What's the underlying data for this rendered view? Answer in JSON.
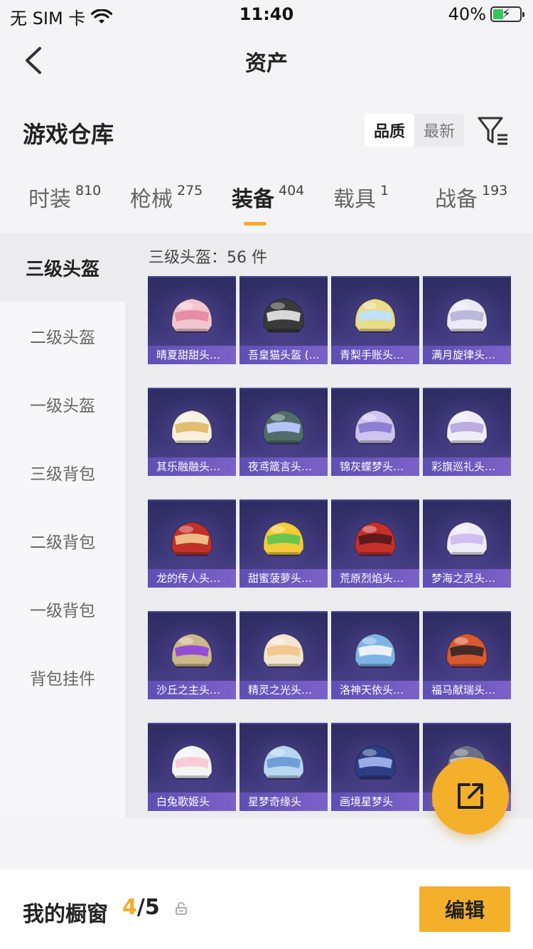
{
  "status_bar": {
    "carrier": "无 SIM 卡",
    "time": "11:40",
    "battery": "40%",
    "battery_level": 0.4
  },
  "nav": {
    "title": "资产"
  },
  "header": {
    "title": "游戏仓库",
    "sort_options": [
      "品质",
      "最新"
    ],
    "active_sort": "品质"
  },
  "tabs": [
    {
      "label": "时装",
      "count": "810"
    },
    {
      "label": "枪械",
      "count": "275"
    },
    {
      "label": "装备",
      "count": "404"
    },
    {
      "label": "载具",
      "count": "1"
    },
    {
      "label": "战备",
      "count": "193"
    }
  ],
  "active_tab": "装备",
  "sidebar": {
    "items": [
      "三级头盔",
      "二级头盔",
      "一级头盔",
      "三级背包",
      "二级背包",
      "一级背包",
      "背包挂件"
    ],
    "active": "三级头盔"
  },
  "grid": {
    "count_label": "三级头盔：56 件",
    "items": [
      {
        "name": "晴夏甜甜头…",
        "color": "#f3c6cf",
        "accent": "#e889a6"
      },
      {
        "name": "吾皇猫头盔 (…",
        "color": "#3a3a3a",
        "accent": "#e0e0e0"
      },
      {
        "name": "青梨手账头…",
        "color": "#e9dc8a",
        "accent": "#bfe3ff"
      },
      {
        "name": "满月旋律头…",
        "color": "#eceaf4",
        "accent": "#b9b5d9"
      },
      {
        "name": "其乐融融头…",
        "color": "#f7f0df",
        "accent": "#e2b96a"
      },
      {
        "name": "夜鸢箴言头…",
        "color": "#4f6e6a",
        "accent": "#b9c7ff"
      },
      {
        "name": "锦灰蝶梦头…",
        "color": "#cfc4ef",
        "accent": "#8a7bd1"
      },
      {
        "name": "彩旗巡礼头…",
        "color": "#f1edf6",
        "accent": "#b7a9e0"
      },
      {
        "name": "龙的传人头…",
        "color": "#c2302a",
        "accent": "#f0c38a"
      },
      {
        "name": "甜蜜菠萝头…",
        "color": "#f2cc3a",
        "accent": "#62c44d"
      },
      {
        "name": "荒原烈焰头…",
        "color": "#c6302b",
        "accent": "#5a1a1a"
      },
      {
        "name": "梦海之灵头…",
        "color": "#f0ecf7",
        "accent": "#cdbcf0"
      },
      {
        "name": "沙丘之主头…",
        "color": "#cdb88b",
        "accent": "#8f47d6"
      },
      {
        "name": "精灵之光头…",
        "color": "#f3e6d0",
        "accent": "#f3c58c"
      },
      {
        "name": "洛神天依头…",
        "color": "#7fb3e6",
        "accent": "#f0f4ff"
      },
      {
        "name": "福马献瑞头…",
        "color": "#d9592f",
        "accent": "#3a2a2a"
      },
      {
        "name": "白兔歌姬头",
        "color": "#f4f4f4",
        "accent": "#f7c9d6"
      },
      {
        "name": "星梦奇缘头",
        "color": "#b9d6f0",
        "accent": "#6a9bd6"
      },
      {
        "name": "画境星梦头",
        "color": "#2c3f86",
        "accent": "#9fb2ea"
      },
      {
        "name": "星",
        "color": "#6c6f86",
        "accent": "#c9c9d4"
      }
    ]
  },
  "share_button": {
    "icon": "share-icon"
  },
  "bottom_bar": {
    "label": "我的橱窗",
    "current": "4",
    "total": "/5",
    "edit_label": "编辑"
  }
}
